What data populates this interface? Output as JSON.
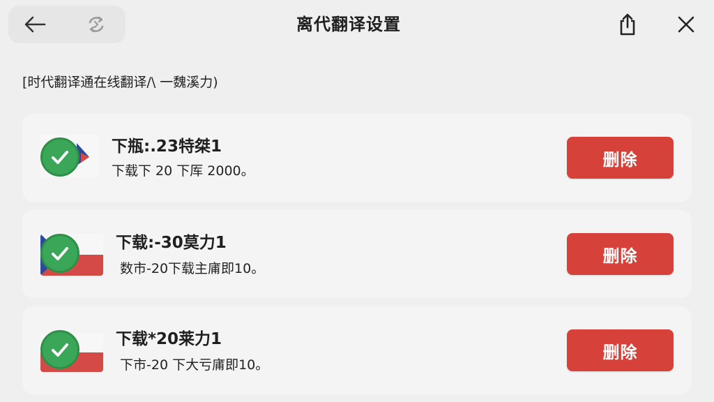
{
  "header": {
    "title": "离代翻译设置",
    "back_icon": "arrow-left-icon",
    "sync_icon": "sync-icon",
    "share_icon": "share-icon",
    "close_icon": "close-icon"
  },
  "subtitle": "[时代翻译通在线翻译/\\ 一魏溪力)",
  "packs": [
    {
      "title": "下瓶:.23特桀1",
      "subtitle": "下载下 20 下厍 2000。",
      "delete_label": "删除",
      "status_icon": "check-circle-icon"
    },
    {
      "title": "下载:-30莫力1",
      "subtitle": "数市-20下载主庯即10。",
      "delete_label": "删除",
      "status_icon": "check-circle-icon"
    },
    {
      "title": "下载*20莱力1",
      "subtitle": "下市-20 下大亏庯即10。",
      "delete_label": "删除",
      "status_icon": "check-circle-icon"
    }
  ],
  "colors": {
    "background": "#efefef",
    "card": "#f4f4f4",
    "delete": "#d6423a",
    "check": "#3aa657",
    "flag_red": "#d44a46"
  }
}
